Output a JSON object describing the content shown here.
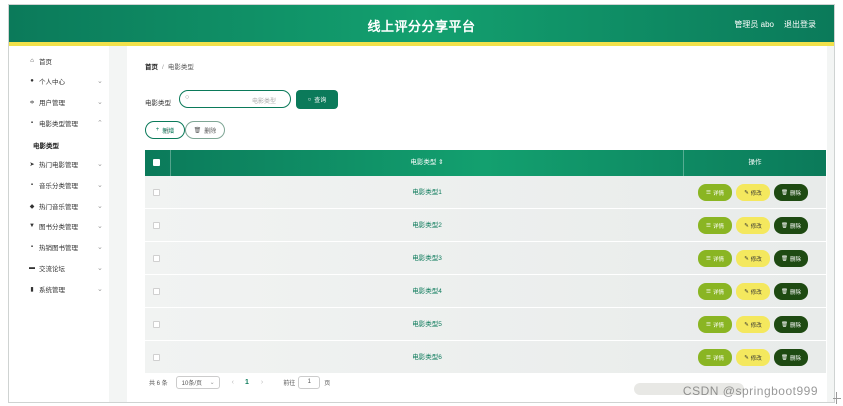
{
  "header": {
    "title": "线上评分分享平台",
    "user": "管理员 abo",
    "logout": "退出登录"
  },
  "sidebar": {
    "items": [
      {
        "label": "首页",
        "icon": "home-icon",
        "glyph": "⌂",
        "chevron": ""
      },
      {
        "label": "个人中心",
        "icon": "person-icon",
        "glyph": "●",
        "chevron": "⌄"
      },
      {
        "label": "用户管理",
        "icon": "sliders-icon",
        "glyph": "≑",
        "chevron": "⌄"
      },
      {
        "label": "电影类型管理",
        "icon": "grid-icon",
        "glyph": "▪",
        "chevron": "⌃"
      },
      {
        "label": "热门电影管理",
        "icon": "send-icon",
        "glyph": "➤",
        "chevron": "⌄"
      },
      {
        "label": "音乐分类管理",
        "icon": "grid-icon",
        "glyph": "▪",
        "chevron": "⌄"
      },
      {
        "label": "热门音乐管理",
        "icon": "location-icon",
        "glyph": "◆",
        "chevron": "⌄"
      },
      {
        "label": "图书分类管理",
        "icon": "trophy-icon",
        "glyph": "▼",
        "chevron": "⌄"
      },
      {
        "label": "热销图书管理",
        "icon": "grid-icon",
        "glyph": "▪",
        "chevron": "⌄"
      },
      {
        "label": "交流论坛",
        "icon": "database-icon",
        "glyph": "▬",
        "chevron": "⌄"
      },
      {
        "label": "系统管理",
        "icon": "bar-chart-icon",
        "glyph": "▮",
        "chevron": "⌄"
      }
    ],
    "sub_item": "电影类型"
  },
  "breadcrumb": {
    "home": "首页",
    "separator": "/",
    "current": "电影类型"
  },
  "filter": {
    "label": "电影类型",
    "placeholder": "电影类型",
    "query_button": "查询"
  },
  "actions": {
    "add": "新增",
    "delete": "删除"
  },
  "table": {
    "headers": {
      "name": "电影类型 ⇕",
      "ops": "操作"
    },
    "rows": [
      {
        "name": "电影类型1"
      },
      {
        "name": "电影类型2"
      },
      {
        "name": "电影类型3"
      },
      {
        "name": "电影类型4"
      },
      {
        "name": "电影类型5"
      },
      {
        "name": "电影类型6"
      }
    ],
    "ops": {
      "detail": "详情",
      "edit": "修改",
      "delete": "删除"
    }
  },
  "pager": {
    "total": "共 6 条",
    "page_size": "10条/页",
    "prev": "‹",
    "current": "1",
    "next": "›",
    "goto_label": "前往",
    "goto_value": "1",
    "page_suffix": "页"
  },
  "watermark": "CSDN @springboot999",
  "colors": {
    "primary": "#0b7a5a",
    "accent": "#f1e14a",
    "detail": "#8ab523",
    "edit": "#f4e85e",
    "delete": "#1e4a12"
  }
}
